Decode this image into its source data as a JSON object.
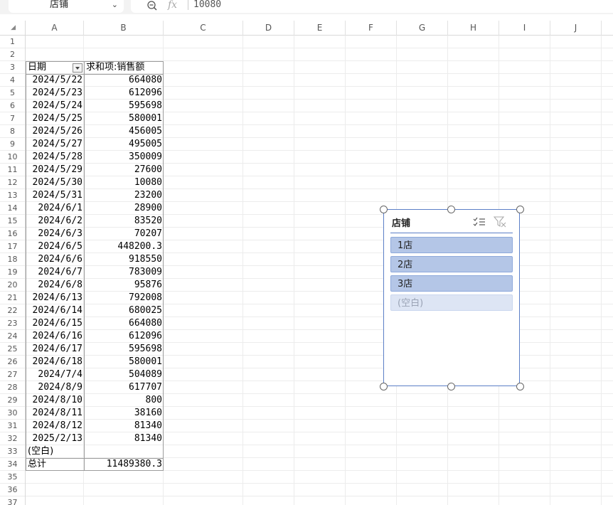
{
  "formula_bar": {
    "name_box": "店铺",
    "fx_symbol": "fx",
    "formula_value": "10080"
  },
  "columns": [
    "A",
    "B",
    "C",
    "D",
    "E",
    "F",
    "G",
    "H",
    "I",
    "J"
  ],
  "rows": [
    "1",
    "2",
    "3",
    "4",
    "5",
    "6",
    "7",
    "8",
    "9",
    "10",
    "11",
    "12",
    "13",
    "14",
    "15",
    "16",
    "17",
    "18",
    "19",
    "20",
    "21",
    "22",
    "23",
    "24",
    "25",
    "26",
    "27",
    "28",
    "29",
    "30",
    "31",
    "32",
    "33",
    "34",
    "35",
    "36",
    "37"
  ],
  "pivot": {
    "header_row_label": "日期",
    "header_value_label": "求和项:销售额",
    "rows": [
      {
        "date": "2024/5/22",
        "value": "664080"
      },
      {
        "date": "2024/5/23",
        "value": "612096"
      },
      {
        "date": "2024/5/24",
        "value": "595698"
      },
      {
        "date": "2024/5/25",
        "value": "580001"
      },
      {
        "date": "2024/5/26",
        "value": "456005"
      },
      {
        "date": "2024/5/27",
        "value": "495005"
      },
      {
        "date": "2024/5/28",
        "value": "350009"
      },
      {
        "date": "2024/5/29",
        "value": "27600"
      },
      {
        "date": "2024/5/30",
        "value": "10080"
      },
      {
        "date": "2024/5/31",
        "value": "23200"
      },
      {
        "date": "2024/6/1",
        "value": "28900"
      },
      {
        "date": "2024/6/2",
        "value": "83520"
      },
      {
        "date": "2024/6/3",
        "value": "70207"
      },
      {
        "date": "2024/6/5",
        "value": "448200.3"
      },
      {
        "date": "2024/6/6",
        "value": "918550"
      },
      {
        "date": "2024/6/7",
        "value": "783009"
      },
      {
        "date": "2024/6/8",
        "value": "95876"
      },
      {
        "date": "2024/6/13",
        "value": "792008"
      },
      {
        "date": "2024/6/14",
        "value": "680025"
      },
      {
        "date": "2024/6/15",
        "value": "664080"
      },
      {
        "date": "2024/6/16",
        "value": "612096"
      },
      {
        "date": "2024/6/17",
        "value": "595698"
      },
      {
        "date": "2024/6/18",
        "value": "580001"
      },
      {
        "date": "2024/7/4",
        "value": "504089"
      },
      {
        "date": "2024/8/9",
        "value": "617707"
      },
      {
        "date": "2024/8/10",
        "value": "800"
      },
      {
        "date": "2024/8/11",
        "value": "38160"
      },
      {
        "date": "2024/8/12",
        "value": "81340"
      },
      {
        "date": "2025/2/13",
        "value": "81340"
      },
      {
        "date": "(空白)",
        "value": ""
      }
    ],
    "total_label": "总计",
    "total_value": "11489380.3"
  },
  "slicer": {
    "title": "店铺",
    "items": [
      {
        "label": "1店",
        "state": "selected"
      },
      {
        "label": "2店",
        "state": "selected"
      },
      {
        "label": "3店",
        "state": "selected"
      },
      {
        "label": "(空白)",
        "state": "no-data"
      }
    ]
  },
  "colors": {
    "slicer_border": "#5b7fc7",
    "slicer_item_selected": "#b4c6e7",
    "slicer_item_nodata": "#dde5f4"
  }
}
